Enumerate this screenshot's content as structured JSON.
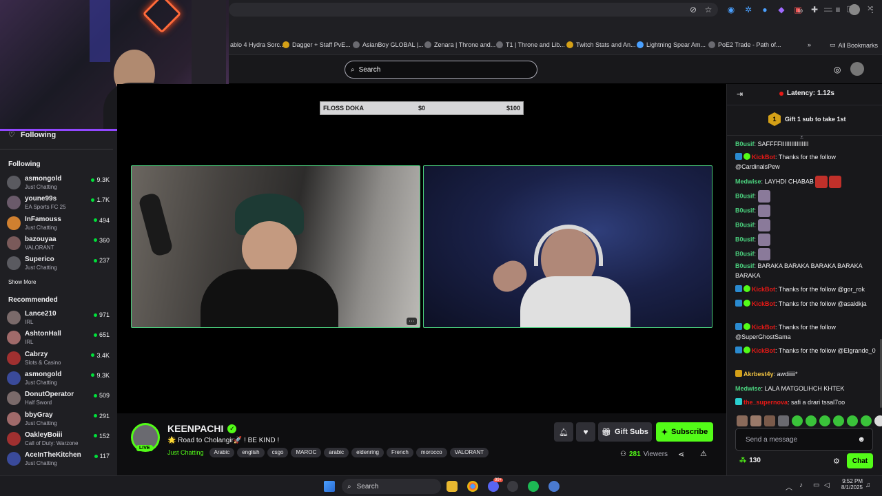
{
  "bookmarks": [
    "ablo 4 Hydra Sorc...",
    "Dagger + Staff PvE...",
    "AsianBoy GLOBAL |...",
    "Zenara | Throne and...",
    "T1 | Throne and Lib...",
    "Twitch Stats and An...",
    "Lightning Spear Am...",
    "PoE2 Trade - Path of..."
  ],
  "all_bookmarks": "All Bookmarks",
  "search": {
    "placeholder": "Search"
  },
  "sidebar": {
    "following_title": "Following",
    "following_section": "Following",
    "following": [
      {
        "name": "asmongold",
        "game": "Just Chatting",
        "viewers": "9.3K"
      },
      {
        "name": "youne99s",
        "game": "EA Sports FC 25",
        "viewers": "1.7K"
      },
      {
        "name": "InFamouss",
        "game": "Just Chatting",
        "viewers": "494"
      },
      {
        "name": "bazouyaa",
        "game": "VALORANT",
        "viewers": "360"
      },
      {
        "name": "Superico",
        "game": "Just Chatting",
        "viewers": "237"
      }
    ],
    "show_more": "Show More",
    "recommended_section": "Recommended",
    "recommended": [
      {
        "name": "Lance210",
        "game": "IRL",
        "viewers": "971"
      },
      {
        "name": "AshtonHall",
        "game": "IRL",
        "viewers": "651"
      },
      {
        "name": "Cabrzy",
        "game": "Slots & Casino",
        "viewers": "3.4K"
      },
      {
        "name": "asmongold",
        "game": "Just Chatting",
        "viewers": "9.3K"
      },
      {
        "name": "DonutOperator",
        "game": "Half Sword",
        "viewers": "509"
      },
      {
        "name": "bbyGray",
        "game": "Just Chatting",
        "viewers": "291"
      },
      {
        "name": "OakleyBoiii",
        "game": "Call of Duty: Warzone",
        "viewers": "152"
      },
      {
        "name": "AceInTheKitchen",
        "game": "Just Chatting",
        "viewers": "117"
      }
    ]
  },
  "overlay": {
    "label": "FLOSS DOKA",
    "start": "$0",
    "end": "$100"
  },
  "stream": {
    "channel": "KEENPACHI",
    "live": "LIVE",
    "title": "🌟 Road to Cholangir🚀 ! BE KIND !",
    "category": "Just Chatting",
    "tags": [
      "Arabic",
      "english",
      "csgo",
      "MAROC",
      "arabic",
      "eldenring",
      "French",
      "morocco",
      "VALORANT"
    ],
    "viewer_count": "281",
    "viewers_label": "Viewers",
    "gift_subs": "Gift Subs",
    "subscribe": "Subscribe"
  },
  "chat": {
    "latency": "Latency: 1.12s",
    "gift_rank": "1",
    "gift_text": "Gift 1 sub to take 1st",
    "messages": [
      {
        "user": "B0usif",
        "color": "#4bd17e",
        "text": "SAFFFFIIIIIIIIIIIIIIII",
        "bot": false
      },
      {
        "user": "KickBot",
        "color": "#e91916",
        "text": "Thanks for the follow @CardinalsPew",
        "bot": true
      },
      {
        "user": "Medwise",
        "color": "#4bd17e",
        "text": "LAYHDI CHABAB",
        "bot": false
      },
      {
        "user": "B0usif",
        "color": "#4bd17e",
        "text": "",
        "bot": false
      },
      {
        "user": "B0usif",
        "color": "#4bd17e",
        "text": "",
        "bot": false
      },
      {
        "user": "B0usif",
        "color": "#4bd17e",
        "text": "",
        "bot": false
      },
      {
        "user": "B0usif",
        "color": "#4bd17e",
        "text": "",
        "bot": false
      },
      {
        "user": "B0usif",
        "color": "#4bd17e",
        "text": "",
        "bot": false
      },
      {
        "user": "B0usif",
        "color": "#4bd17e",
        "text": "BARAKA BARAKA BARAKA BARAKA BARAKA",
        "bot": false
      },
      {
        "user": "KickBot",
        "color": "#e91916",
        "text": "Thanks for the follow @gor_rok",
        "bot": true
      },
      {
        "user": "KickBot",
        "color": "#e91916",
        "text": "Thanks for the follow @asaldkja",
        "bot": true
      },
      {
        "user": "KickBot",
        "color": "#e91916",
        "text": "Thanks for the follow @SuperGhostSama",
        "bot": true
      },
      {
        "user": "KickBot",
        "color": "#e91916",
        "text": "Thanks for the follow @Elgrande_0",
        "bot": true
      },
      {
        "user": "Akrbest4y",
        "color": "#f4c542",
        "text": "awdiiiii*",
        "bot": false
      },
      {
        "user": "Medwise",
        "color": "#4bd17e",
        "text": "LALA MATGOLIHCH KHTEK",
        "bot": false
      },
      {
        "user": "the_supernova",
        "color": "#e91916",
        "text": "safi a drari tssal7oo",
        "bot": false
      }
    ],
    "input_placeholder": "Send a message",
    "points": "130",
    "chat_button": "Chat"
  },
  "taskbar": {
    "search": "Search",
    "time": "9:52 PM",
    "date": "8/1/2025",
    "badge_a": "99+",
    "badge_b": "10"
  },
  "colors": {
    "kick_green": "#53fc18",
    "twitch_purple": "#9147ff"
  }
}
